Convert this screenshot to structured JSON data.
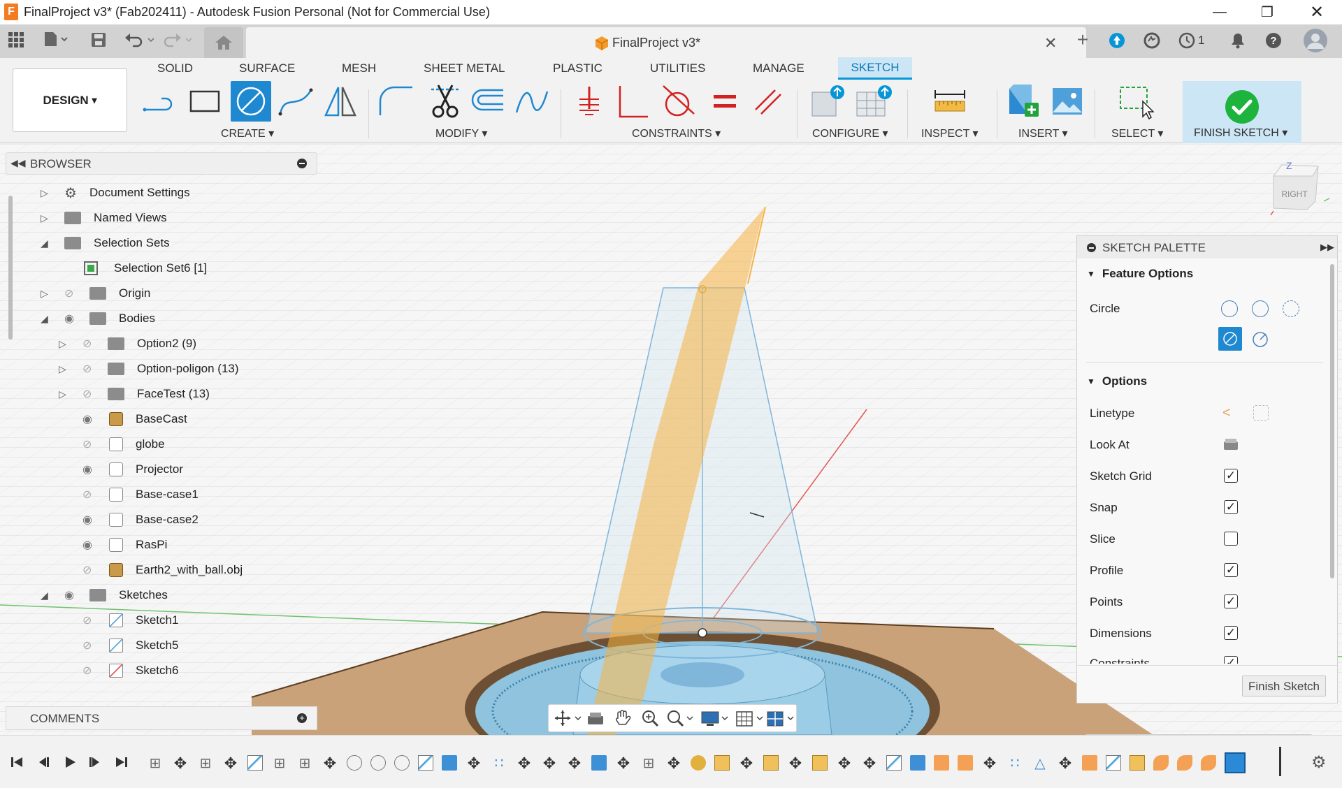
{
  "window": {
    "title": "FinalProject v3* (Fab202411) - Autodesk Fusion Personal (Not for Commercial Use)",
    "controls": [
      "minimize-icon",
      "restore-icon",
      "close-icon"
    ]
  },
  "tabbar": {
    "document_tab": "FinalProject v3*",
    "job_count": "1"
  },
  "ribbon": {
    "workspace": "DESIGN",
    "tabs": [
      "SOLID",
      "SURFACE",
      "MESH",
      "SHEET METAL",
      "PLASTIC",
      "UTILITIES",
      "MANAGE",
      "SKETCH"
    ],
    "active_tab": "SKETCH",
    "groups": {
      "create": "CREATE",
      "modify": "MODIFY",
      "constraints": "CONSTRAINTS",
      "configure": "CONFIGURE",
      "inspect": "INSPECT",
      "insert": "INSERT",
      "select": "SELECT",
      "finish": "FINISH SKETCH"
    },
    "dropdown_caret": "▾"
  },
  "browser": {
    "title": "BROWSER",
    "items": [
      {
        "label": "Document Settings"
      },
      {
        "label": "Named Views"
      },
      {
        "label": "Selection Sets"
      },
      {
        "label": "Selection Set6 [1]"
      },
      {
        "label": "Origin"
      },
      {
        "label": "Bodies"
      },
      {
        "label": "Option2 (9)"
      },
      {
        "label": "Option-poligon (13)"
      },
      {
        "label": "FaceTest (13)"
      },
      {
        "label": "BaseCast"
      },
      {
        "label": "globe"
      },
      {
        "label": "Projector"
      },
      {
        "label": "Base-case1"
      },
      {
        "label": "Base-case2"
      },
      {
        "label": "RasPi"
      },
      {
        "label": "Earth2_with_ball.obj"
      },
      {
        "label": "Sketches"
      },
      {
        "label": "Sketch1"
      },
      {
        "label": "Sketch5"
      },
      {
        "label": "Sketch6"
      }
    ]
  },
  "comments": {
    "title": "COMMENTS"
  },
  "viewcube": {
    "face": "RIGHT",
    "axis_z": "Z"
  },
  "sketch_palette": {
    "title": "SKETCH PALETTE",
    "feature_options": {
      "title": "Feature Options",
      "circle_label": "Circle"
    },
    "options": {
      "title": "Options",
      "rows": [
        {
          "label": "Linetype"
        },
        {
          "label": "Look At"
        },
        {
          "label": "Sketch Grid",
          "checked": true
        },
        {
          "label": "Snap",
          "checked": true
        },
        {
          "label": "Slice",
          "checked": false
        },
        {
          "label": "Profile",
          "checked": true
        },
        {
          "label": "Points",
          "checked": true
        },
        {
          "label": "Dimensions",
          "checked": true
        },
        {
          "label": "Constraints",
          "checked": true
        }
      ]
    },
    "finish_button": "Finish Sketch"
  },
  "colors": {
    "accent": "#0696d7",
    "active_tab_bg": "#cde6f5",
    "finish_green": "#1db33d",
    "sketch_blue": "#7fb6da",
    "plane_orange": "#f5b342",
    "wood": "#c9a27a"
  }
}
